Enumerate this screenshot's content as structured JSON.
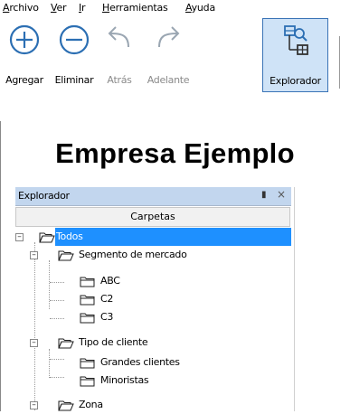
{
  "menu": [
    {
      "label": "Archivo",
      "mnemonic": "A",
      "rest": "rchivo"
    },
    {
      "label": "Ver",
      "mnemonic": "V",
      "rest": "er"
    },
    {
      "label": "Ir",
      "mnemonic": "I",
      "rest": "r"
    },
    {
      "label": "Herramientas",
      "mnemonic": "H",
      "rest": "erramientas"
    },
    {
      "label": "Ayuda",
      "mnemonic": "A",
      "rest": "yuda"
    }
  ],
  "toolbar": {
    "add_label": "Agregar",
    "remove_label": "Eliminar",
    "back_label": "Atrás",
    "forward_label": "Adelante",
    "explorer_label": "Explorador"
  },
  "company_title": "Empresa Ejemplo",
  "explorer": {
    "title": "Explorador",
    "pin_glyph": "✷",
    "close_glyph": "×",
    "tab_label": "Carpetas"
  },
  "tree": [
    {
      "label": "Todos",
      "level": 0,
      "expanded": true,
      "selected": true,
      "icon": "open-folder-icon"
    },
    {
      "label": "Segmento de mercado",
      "level": 1,
      "expanded": true,
      "selected": false,
      "icon": "open-folder-icon"
    },
    {
      "label": "ABC",
      "level": 2,
      "selected": false,
      "icon": "folder-icon"
    },
    {
      "label": "C2",
      "level": 2,
      "selected": false,
      "icon": "folder-icon"
    },
    {
      "label": "C3",
      "level": 2,
      "selected": false,
      "icon": "folder-icon"
    },
    {
      "label": "Tipo de cliente",
      "level": 1,
      "expanded": true,
      "selected": false,
      "icon": "open-folder-icon"
    },
    {
      "label": "Grandes clientes",
      "level": 2,
      "selected": false,
      "icon": "folder-icon"
    },
    {
      "label": "Minoristas",
      "level": 2,
      "selected": false,
      "icon": "folder-icon"
    },
    {
      "label": "Zona",
      "level": 1,
      "expanded": true,
      "selected": false,
      "icon": "open-folder-icon"
    }
  ],
  "colors": {
    "accent": "#1e90ff",
    "panel_header": "#c2d6ee",
    "toolbar_icon": "#2c6fb3",
    "disabled_icon": "#9aa6b2"
  }
}
